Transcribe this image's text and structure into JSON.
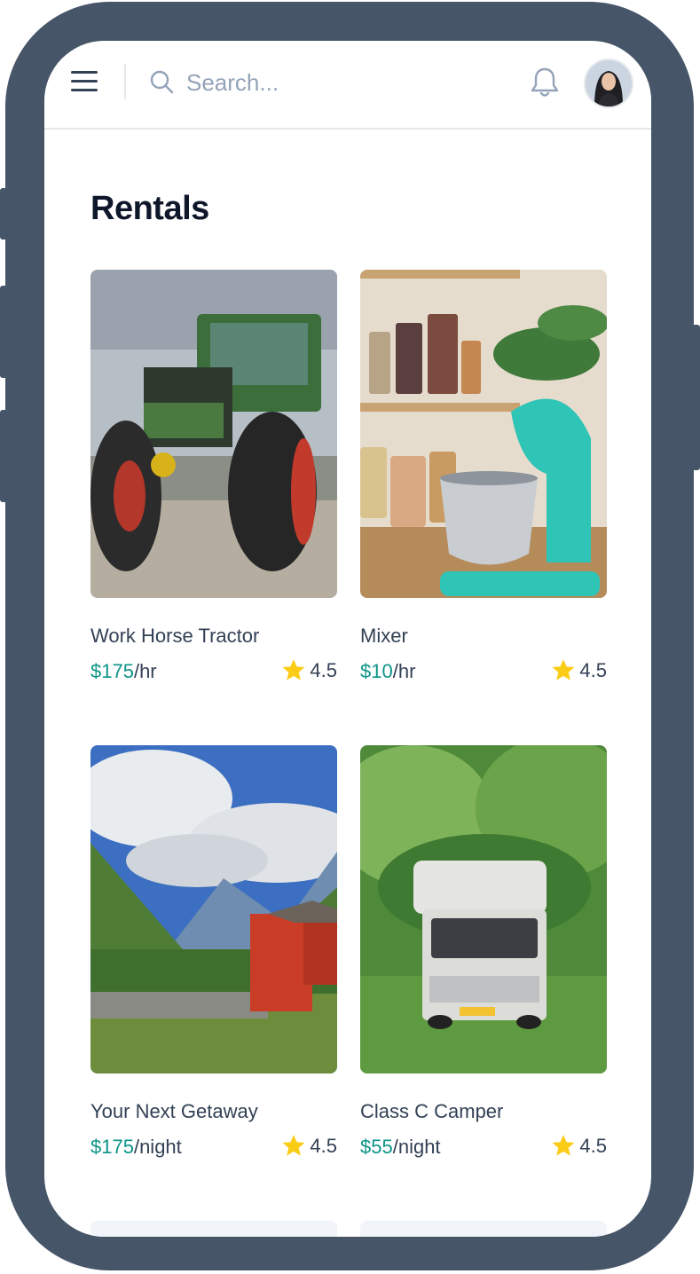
{
  "header": {
    "search_placeholder": "Search...",
    "icons": [
      "menu-icon",
      "search-icon",
      "bell-icon",
      "avatar"
    ]
  },
  "page": {
    "title": "Rentals"
  },
  "listings": [
    {
      "name": "Work Horse Tractor",
      "price": "$175",
      "unit": "/hr",
      "rating": "4.5",
      "image": "tractor-photo"
    },
    {
      "name": "Mixer",
      "price": "$10",
      "unit": "/hr",
      "rating": "4.5",
      "image": "stand-mixer-photo"
    },
    {
      "name": "Your Next Getaway",
      "price": "$175",
      "unit": "/night",
      "rating": "4.5",
      "image": "mountain-cabin-photo"
    },
    {
      "name": "Class C Camper",
      "price": "$55",
      "unit": "/night",
      "rating": "4.5",
      "image": "camper-van-photo"
    }
  ],
  "colors": {
    "frame": "#475569",
    "accent_price": "#0d9488",
    "star": "#facc15",
    "title": "#0f172a"
  }
}
